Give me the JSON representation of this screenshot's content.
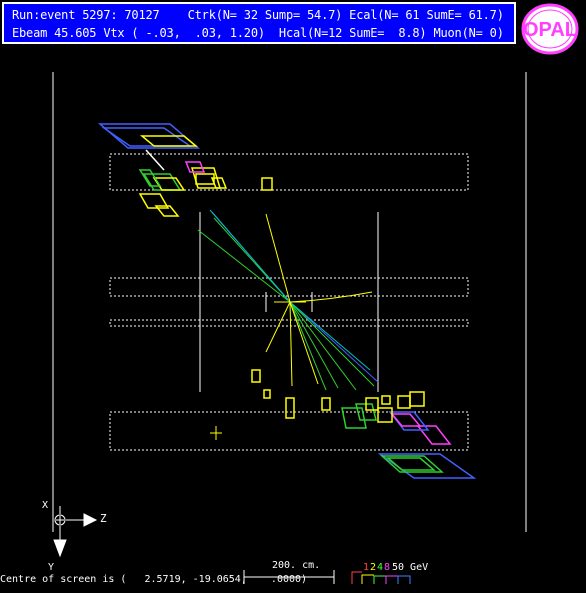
{
  "header": {
    "line1": "Run:event 5297: 70127    Ctrk(N= 32 Sump= 54.7) Ecal(N= 61 SumE= 61.7)",
    "line2": "Ebeam 45.605 Vtx ( -.03,  .03, 1.20)  Hcal(N=12 SumE=  8.8) Muon(N= 0)"
  },
  "logo": {
    "text": "OPAL"
  },
  "axes": {
    "x_label": "X",
    "z_label": "Z",
    "y_label": "Y"
  },
  "scale": {
    "label": "200. cm."
  },
  "energy_legend": {
    "values": [
      "1",
      "2",
      "4",
      "8"
    ],
    "unit": "50 GeV",
    "colors": [
      "#ff4040",
      "#ffff00",
      "#40ff40",
      "#ff40ff",
      "#4080ff"
    ]
  },
  "footer": {
    "centre_text": "Centre of screen is (   2.5719, -19.0654,    .0000)"
  },
  "colors": {
    "header_bg": "#0000ff",
    "track_blue": "#4060ff",
    "track_green": "#30d030",
    "track_yellow": "#ffff00",
    "ecal_magenta": "#ff40ff"
  }
}
